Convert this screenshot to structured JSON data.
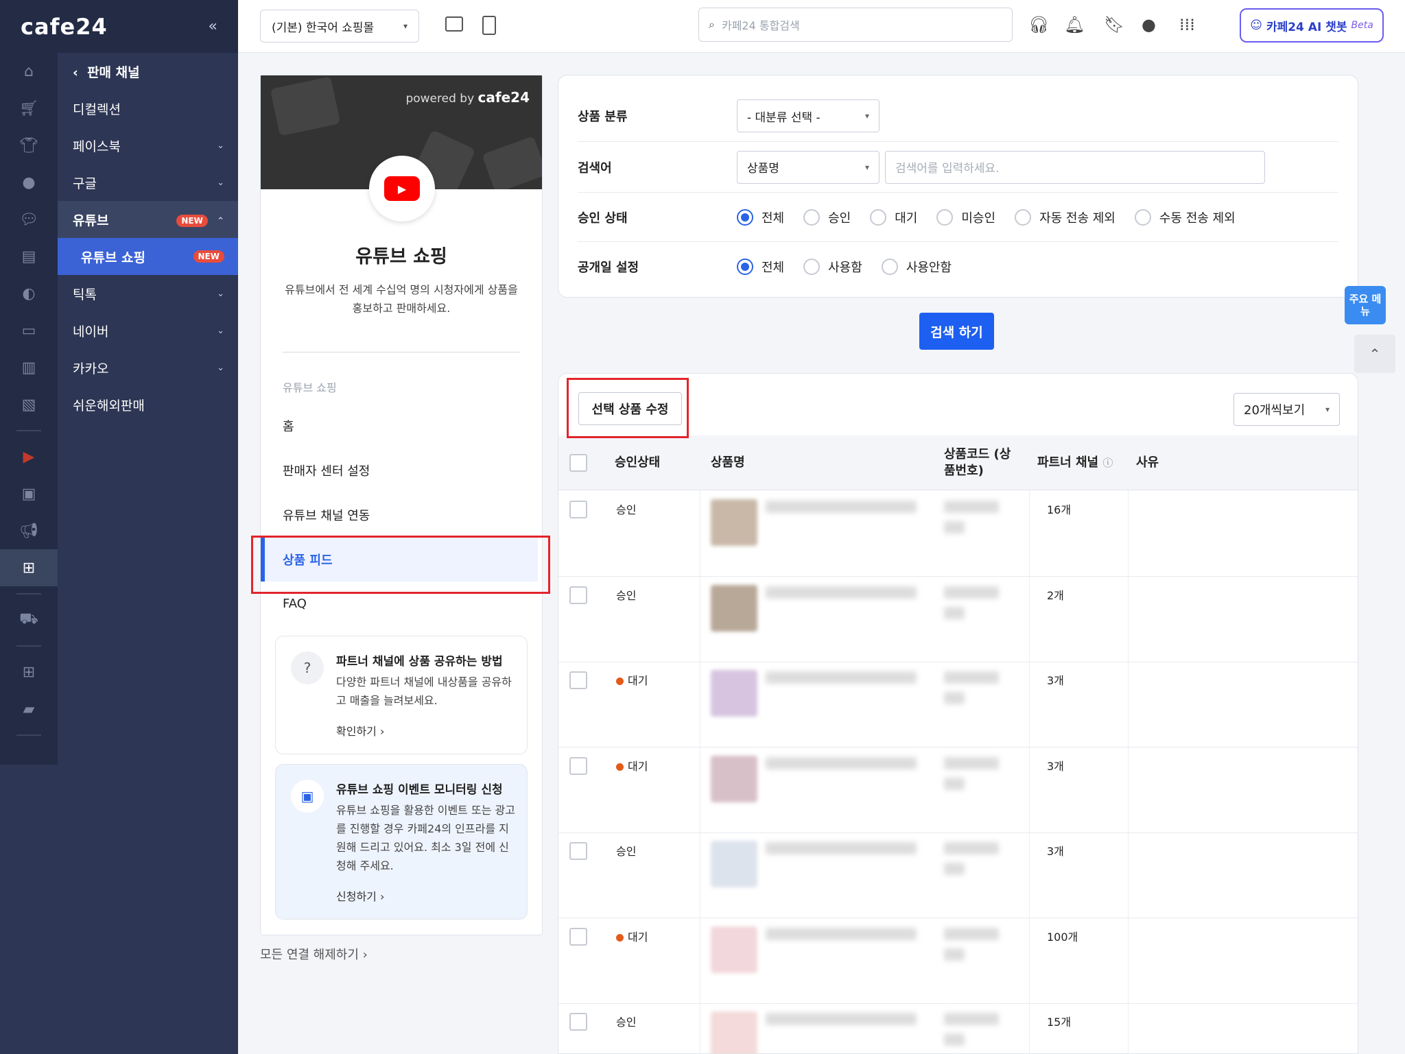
{
  "app": {
    "logo": "cafe24",
    "collapse_icon": "«"
  },
  "topbar": {
    "mall_select": "(기본) 한국어 쇼핑몰",
    "search_placeholder": "카페24 통합검색",
    "ai_button": "카페24 AI 챗봇",
    "ai_beta": "Beta"
  },
  "submenu": {
    "header": "판매 채널",
    "items": [
      {
        "label": "디컬렉션"
      },
      {
        "label": "페이스북"
      },
      {
        "label": "구글"
      },
      {
        "label": "유튜브",
        "badge": "NEW"
      },
      {
        "label": "유튜브 쇼핑",
        "badge": "NEW"
      },
      {
        "label": "틱톡"
      },
      {
        "label": "네이버"
      },
      {
        "label": "카카오"
      },
      {
        "label": "쉬운해외판매"
      }
    ]
  },
  "left_panel": {
    "powered_by": "powered by",
    "powered_brand": "cafe24",
    "title": "유튜브 쇼핑",
    "description": "유튜브에서 전 세계 수십억 명의 시청자에게 상품을 홍보하고 판매하세요.",
    "section_label": "유튜브 쇼핑",
    "nav": [
      "홈",
      "판매자 센터 설정",
      "유튜브 채널 연동",
      "상품 피드",
      "FAQ"
    ],
    "card1": {
      "title": "파트너 채널에 상품 공유하는 방법",
      "body": "다양한 파트너 채널에 내상품을 공유하고 매출을 늘려보세요.",
      "link": "확인하기 ›"
    },
    "card2": {
      "title": "유튜브 쇼핑 이벤트 모니터링 신청",
      "body": "유튜브 쇼핑을 활용한 이벤트 또는 광고를 진행할 경우 카페24의 인프라를 지원해 드리고 있어요. 최소 3일 전에 신청해 주세요.",
      "link": "신청하기 ›"
    },
    "disconnect": "모든 연결 해제하기 ›"
  },
  "filter": {
    "category_label": "상품 분류",
    "category_value": "- 대분류 선택 -",
    "keyword_label": "검색어",
    "keyword_type": "상품명",
    "keyword_placeholder": "검색어를 입력하세요.",
    "approval_label": "승인 상태",
    "approval_options": [
      "전체",
      "승인",
      "대기",
      "미승인",
      "자동 전송 제외",
      "수동 전송 제외"
    ],
    "publish_label": "공개일 설정",
    "publish_options": [
      "전체",
      "사용함",
      "사용안함"
    ],
    "search_button": "검색 하기"
  },
  "floating": {
    "quick_menu": "주요 메뉴"
  },
  "results": {
    "edit_button": "선택 상품 수정",
    "per_page": "20개씩보기",
    "columns": [
      "승인상태",
      "상품명",
      "상품코드 (상품번호)",
      "파트너 채널",
      "사유"
    ],
    "rows": [
      {
        "status": "승인",
        "pending": false,
        "channels": "16개"
      },
      {
        "status": "승인",
        "pending": false,
        "channels": "2개"
      },
      {
        "status": "대기",
        "pending": true,
        "channels": "3개"
      },
      {
        "status": "대기",
        "pending": true,
        "channels": "3개"
      },
      {
        "status": "승인",
        "pending": false,
        "channels": "3개"
      },
      {
        "status": "대기",
        "pending": true,
        "channels": "100개"
      },
      {
        "status": "승인",
        "pending": false,
        "channels": "15개"
      }
    ]
  }
}
